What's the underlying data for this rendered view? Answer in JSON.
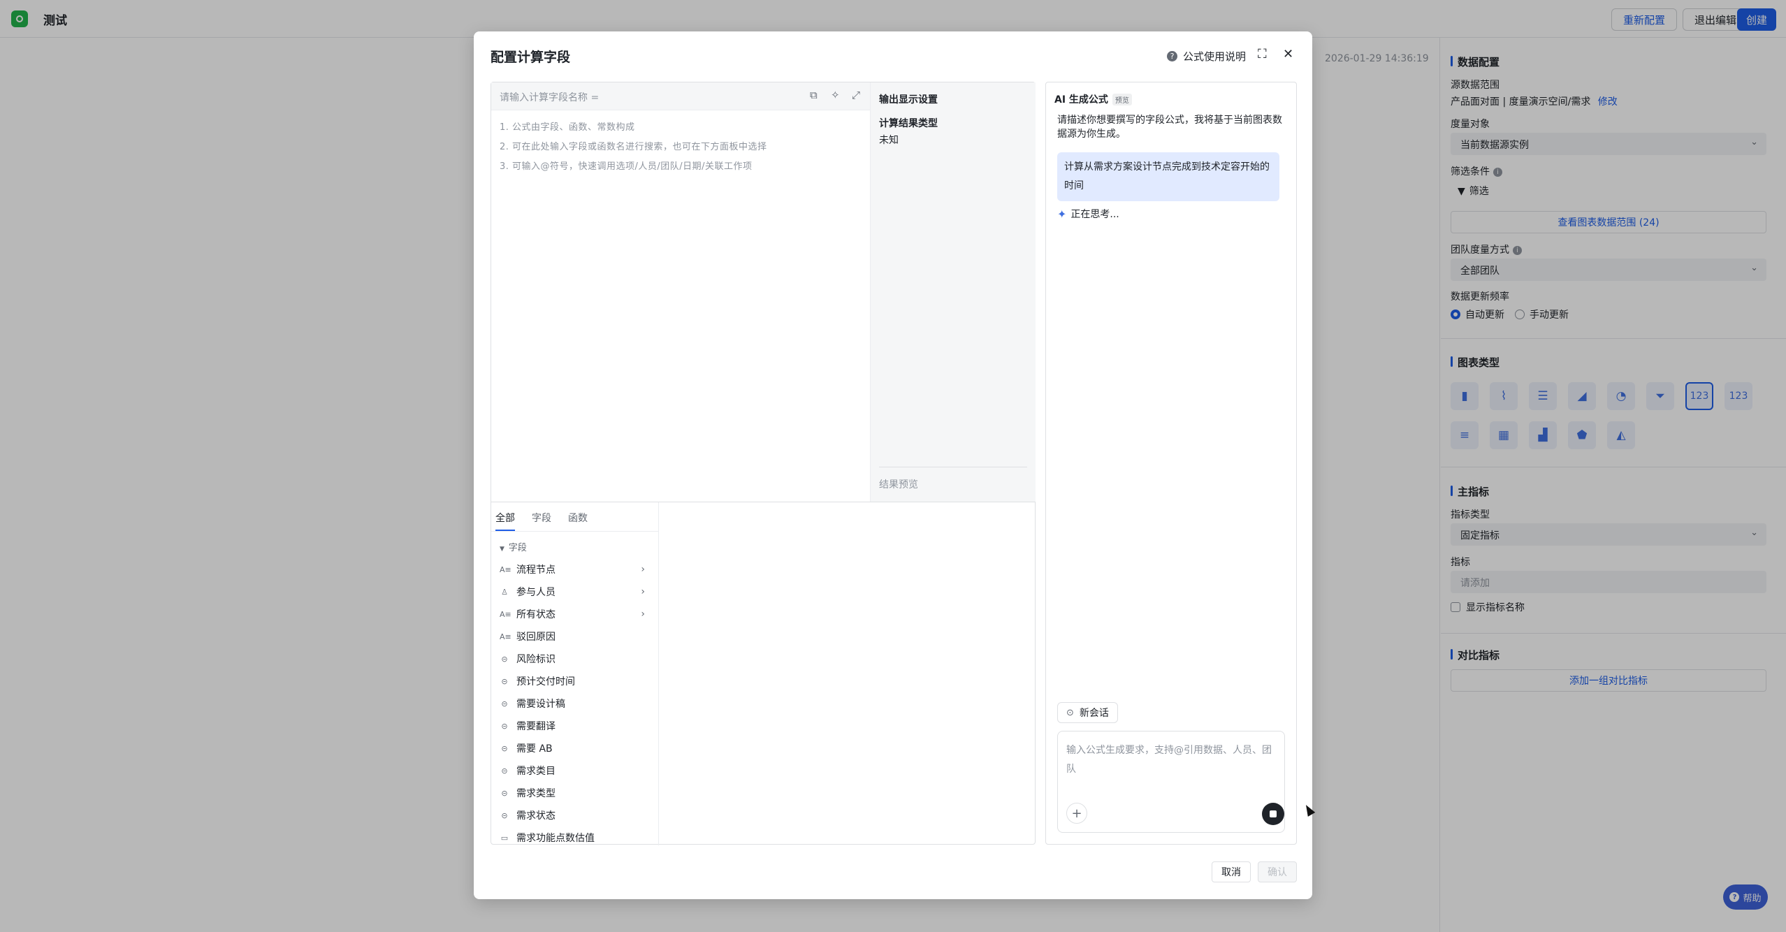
{
  "app": {
    "title": "测试"
  },
  "toolbar": {
    "reconfigure": "重新配置",
    "exit_edit": "退出编辑",
    "create": "创建"
  },
  "timestamp": "2026-01-29 14:36:19",
  "right_panel": {
    "data_config": "数据配置",
    "source_range_label": "源数据范围",
    "source_range_value": "产品面对面 | 度量演示空间/需求",
    "modify": "修改",
    "measure_object_label": "度量对象",
    "measure_object_value": "当前数据源实例",
    "filter_label": "筛选条件",
    "filter_button": "筛选",
    "view_range_button": "查看图表数据范围 (24)",
    "team_measure_label": "团队度量方式",
    "team_measure_value": "全部团队",
    "update_freq_label": "数据更新频率",
    "auto_update": "自动更新",
    "manual_update": "手动更新",
    "chart_type_title": "图表类型",
    "chart_types": [
      {
        "icon": "bar-chart-icon",
        "glyph": "▮"
      },
      {
        "icon": "line-chart-icon",
        "glyph": "⌇"
      },
      {
        "icon": "horizontal-bar-icon",
        "glyph": "☰"
      },
      {
        "icon": "area-chart-icon",
        "glyph": "◢"
      },
      {
        "icon": "pie-chart-icon",
        "glyph": "◔"
      },
      {
        "icon": "funnel-chart-icon",
        "glyph": "⏷"
      },
      {
        "icon": "metric-card-icon",
        "glyph": "123"
      },
      {
        "icon": "number-icon",
        "glyph": "123"
      },
      {
        "icon": "table-icon",
        "glyph": "≡"
      },
      {
        "icon": "pivot-table-icon",
        "glyph": "▦"
      },
      {
        "icon": "waterfall-icon",
        "glyph": "▟"
      },
      {
        "icon": "radar-chart-icon",
        "glyph": "⬟"
      },
      {
        "icon": "combo-chart-icon",
        "glyph": "◭"
      }
    ],
    "active_chart_type": 6,
    "main_metric_title": "主指标",
    "metric_type_label": "指标类型",
    "metric_type_value": "固定指标",
    "metric_label": "指标",
    "metric_placeholder": "请添加",
    "show_metric_name": "显示指标名称",
    "compare_title": "对比指标",
    "add_compare": "添加一组对比指标"
  },
  "modal": {
    "title": "配置计算字段",
    "help_link": "公式使用说明",
    "name_placeholder": "请输入计算字段名称 =",
    "hints": [
      "1. 公式由字段、函数、常数构成",
      "2. 可在此处输入字段或函数名进行搜索，也可在下方面板中选择",
      "3. 可输入@符号，快速调用选项/人员/团队/日期/关联工作项"
    ],
    "output_title": "输出显示设置",
    "result_type_label": "计算结果类型",
    "result_type_value": "未知",
    "result_preview": "结果预览",
    "tabs": [
      "全部",
      "字段",
      "函数"
    ],
    "field_group": "字段",
    "fields": [
      {
        "icon": "A≡",
        "name": "流程节点",
        "expand": true
      },
      {
        "icon": "♙",
        "name": "参与人员",
        "expand": true
      },
      {
        "icon": "A≡",
        "name": "所有状态",
        "expand": true
      },
      {
        "icon": "A≡",
        "name": "驳回原因",
        "expand": false
      },
      {
        "icon": "⊝",
        "name": "风险标识",
        "expand": false
      },
      {
        "icon": "⊝",
        "name": "预计交付时间",
        "expand": false
      },
      {
        "icon": "⊝",
        "name": "需要设计稿",
        "expand": false
      },
      {
        "icon": "⊝",
        "name": "需要翻译",
        "expand": false
      },
      {
        "icon": "⊝",
        "name": "需要 AB",
        "expand": false
      },
      {
        "icon": "⊝",
        "name": "需求类目",
        "expand": false
      },
      {
        "icon": "⊝",
        "name": "需求类型",
        "expand": false
      },
      {
        "icon": "⊝",
        "name": "需求状态",
        "expand": false
      },
      {
        "icon": "▭",
        "name": "需求功能点数估值",
        "expand": false
      }
    ],
    "ai": {
      "title": "AI 生成公式",
      "badge": "预览",
      "description": "请描述你想要撰写的字段公式，我将基于当前图表数据源为你生成。",
      "user_message": "计算从需求方案设计节点完成到技术定容开始的时间",
      "thinking": "正在思考...",
      "new_chat": "新会话",
      "input_placeholder": "输入公式生成要求，支持@引用数据、人员、团队"
    },
    "cancel": "取消",
    "confirm": "确认"
  },
  "help_fab": "帮助"
}
